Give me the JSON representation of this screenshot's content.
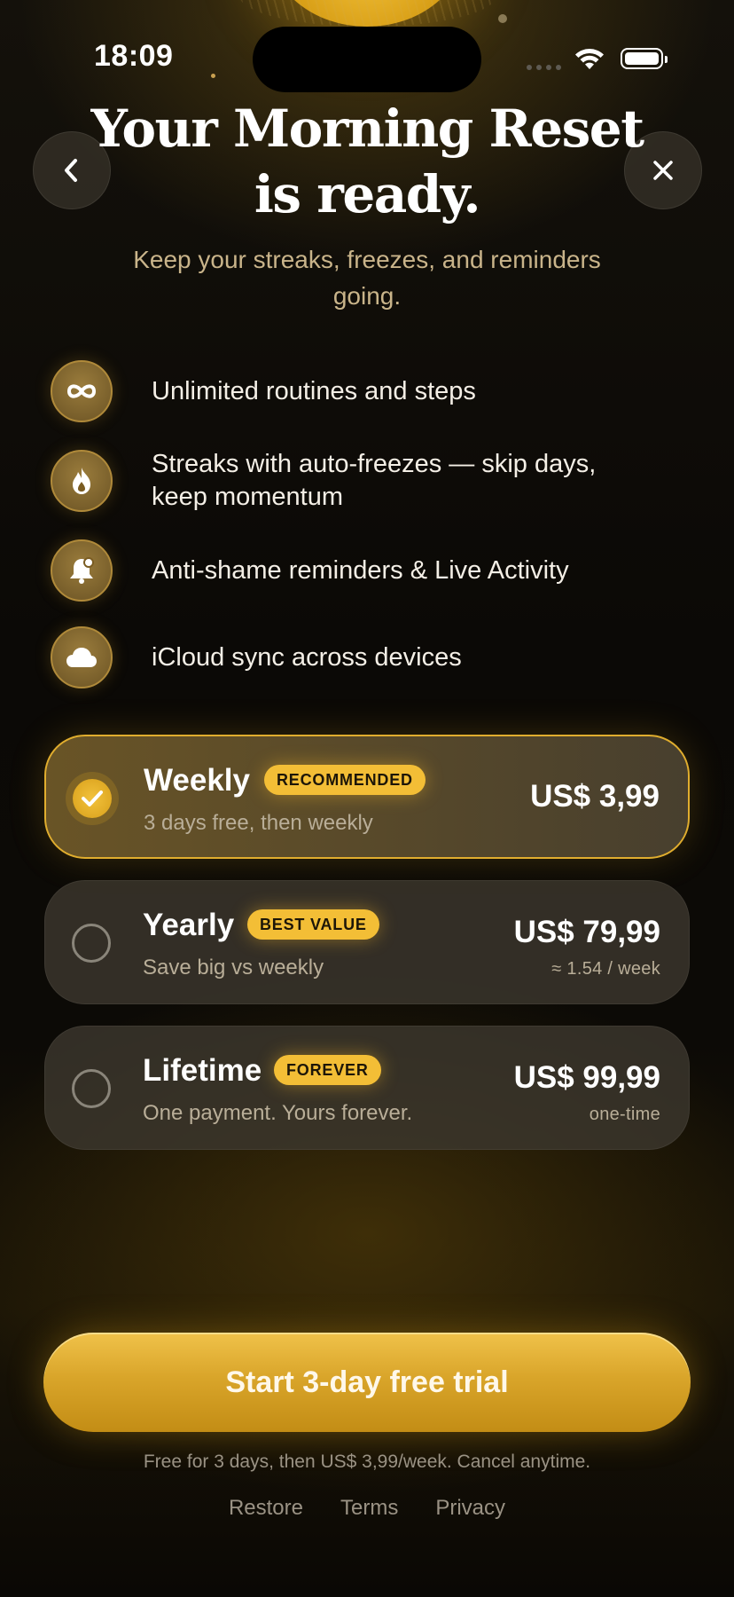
{
  "status_bar": {
    "time": "18:09"
  },
  "header": {
    "title": "Your Morning Reset is ready.",
    "subtitle": "Keep your streaks, freezes, and reminders going."
  },
  "features": [
    {
      "icon": "infinity-icon",
      "text": "Unlimited routines and steps"
    },
    {
      "icon": "flame-icon",
      "text": "Streaks with auto-freezes — skip days, keep momentum"
    },
    {
      "icon": "bell-icon",
      "text": "Anti-shame reminders & Live Activity"
    },
    {
      "icon": "cloud-icon",
      "text": "iCloud sync across devices"
    }
  ],
  "plans": [
    {
      "name": "Weekly",
      "badge": "RECOMMENDED",
      "subtitle": "3 days free, then weekly",
      "price": "US$ 3,99",
      "note": "",
      "selected": true
    },
    {
      "name": "Yearly",
      "badge": "BEST VALUE",
      "subtitle": "Save big vs weekly",
      "price": "US$ 79,99",
      "note": "≈ 1.54 / week",
      "selected": false
    },
    {
      "name": "Lifetime",
      "badge": "FOREVER",
      "subtitle": "One payment. Yours forever.",
      "price": "US$ 99,99",
      "note": "one-time",
      "selected": false
    }
  ],
  "cta": {
    "label": "Start 3-day free trial"
  },
  "fine_print": "Free for 3 days, then US$ 3,99/week. Cancel anytime.",
  "links": {
    "restore": "Restore",
    "terms": "Terms",
    "privacy": "Privacy"
  },
  "colors": {
    "accent": "#f3be36",
    "accent_dark": "#d89f1a",
    "background": "#0b0906",
    "muted_text": "#c9b48a"
  }
}
